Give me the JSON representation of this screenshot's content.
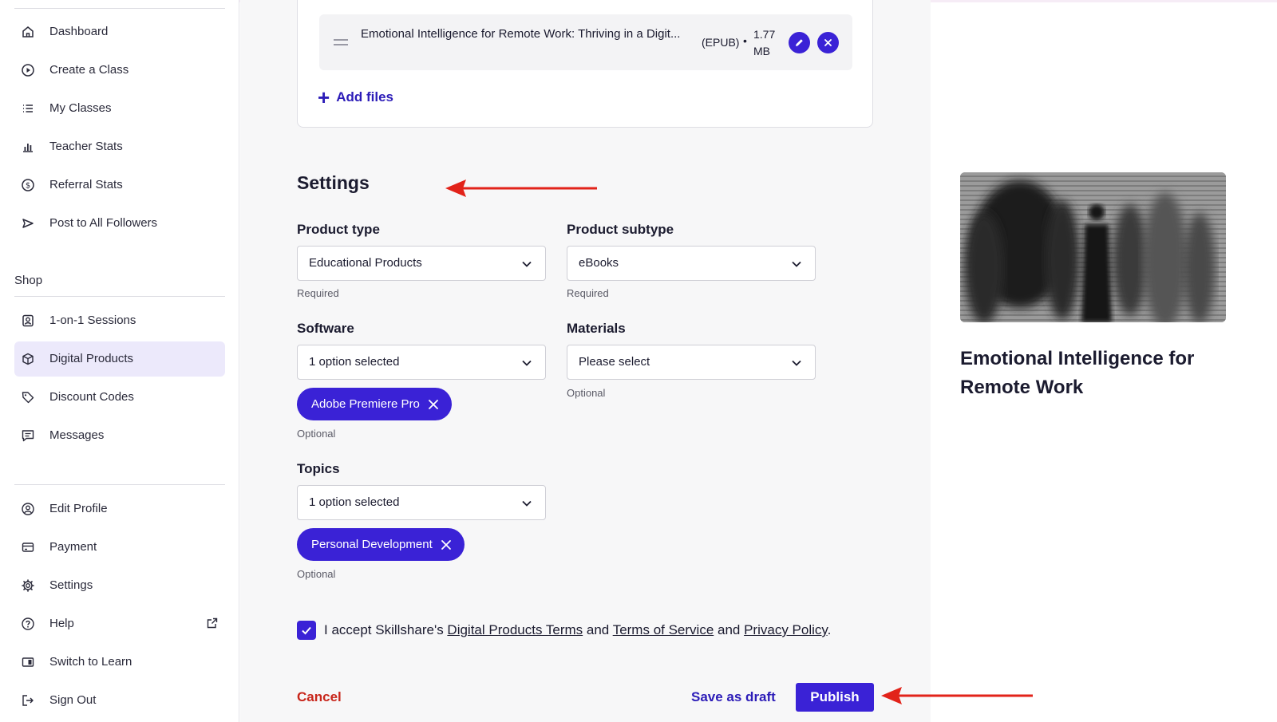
{
  "sidebar": {
    "top_items": [
      {
        "label": "Dashboard",
        "icon": "home-icon"
      },
      {
        "label": "Create a Class",
        "icon": "play-circle-icon"
      },
      {
        "label": "My Classes",
        "icon": "list-icon"
      },
      {
        "label": "Teacher Stats",
        "icon": "bar-chart-icon"
      },
      {
        "label": "Referral Stats",
        "icon": "dollar-circle-icon"
      },
      {
        "label": "Post to All Followers",
        "icon": "send-icon"
      }
    ],
    "shop_heading": "Shop",
    "shop_items": [
      {
        "label": "1-on-1 Sessions",
        "icon": "person-frame-icon"
      },
      {
        "label": "Digital Products",
        "icon": "cube-icon",
        "active": true
      },
      {
        "label": "Discount Codes",
        "icon": "tag-icon"
      },
      {
        "label": "Messages",
        "icon": "message-icon"
      }
    ],
    "bottom_items": [
      {
        "label": "Edit Profile",
        "icon": "user-circle-icon"
      },
      {
        "label": "Payment",
        "icon": "card-icon"
      },
      {
        "label": "Settings",
        "icon": "gear-icon"
      },
      {
        "label": "Help",
        "icon": "help-icon"
      },
      {
        "label": "Switch to Learn",
        "icon": "switch-icon"
      },
      {
        "label": "Sign Out",
        "icon": "sign-out-icon"
      }
    ]
  },
  "files": {
    "file_name": "Emotional Intelligence for Remote Work: Thriving in a Digit...",
    "file_type": "(EPUB)",
    "separator": "•",
    "file_size": "1.77 MB",
    "add_files_label": "Add files"
  },
  "settings": {
    "title": "Settings",
    "product_type": {
      "label": "Product type",
      "value": "Educational Products",
      "hint": "Required"
    },
    "product_subtype": {
      "label": "Product subtype",
      "value": "eBooks",
      "hint": "Required"
    },
    "software": {
      "label": "Software",
      "value": "1 option selected",
      "chip": "Adobe Premiere Pro",
      "hint": "Optional"
    },
    "materials": {
      "label": "Materials",
      "value": "Please select",
      "hint": "Optional"
    },
    "topics": {
      "label": "Topics",
      "value": "1 option selected",
      "chip": "Personal Development",
      "hint": "Optional"
    }
  },
  "terms": {
    "prefix": "I accept Skillshare's ",
    "link1": "Digital Products Terms",
    "and1": " and ",
    "link2": "Terms of Service",
    "and2": " and ",
    "link3": "Privacy Policy",
    "suffix": ".",
    "checked": true
  },
  "actions": {
    "cancel": "Cancel",
    "save_draft": "Save as draft",
    "publish": "Publish"
  },
  "preview": {
    "title": "Emotional Intelligence for Remote Work"
  },
  "colors": {
    "accent": "#3a22d6",
    "cancel": "#c8261b",
    "annotation_arrow": "#e2231a",
    "active_bg": "#ece9fb"
  }
}
